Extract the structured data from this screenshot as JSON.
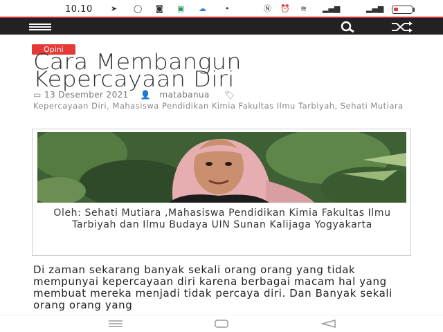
{
  "status_bar": {
    "time": "10.10",
    "icons": [
      "telegram-icon",
      "whatsapp-icon",
      "camera-icon",
      "app-icon",
      "cloud-icon",
      "dot-icon",
      "nfc-icon",
      "alarm-icon",
      "wifi-icon",
      "signal-icon"
    ],
    "battery_level": 0.25,
    "battery_color": "#e53935"
  },
  "header": {
    "menu_icon": "hamburger-menu-icon",
    "search_icon": "search-icon",
    "shuffle_icon": "shuffle-icon",
    "background": "#222222",
    "accent": "#d32f2f"
  },
  "article": {
    "category": "Opini",
    "title_line1": "Cara Membangun",
    "title_line2": "Kepercayaan Diri",
    "date": "13 Desember 2021",
    "author": "matabanua",
    "tags": [
      "Kepercayaan Diri",
      "Mahasiswa Pendidikan Kimia Fakultas Ilmu Tarbiyah",
      "Sehati Mutiara"
    ],
    "caption": "Oleh: Sehati Mutiara ,Mahasiswa Pendidikan Kimia Fakultas Ilmu Tarbiyah dan Ilmu Budaya UIN Sunan Kalijaga Yogyakarta",
    "body": "Di zaman sekarang banyak sekali orang orang yang tidak mempunyai kepercayaan diri karena berbagai macam hal yang membuat mereka menjadi tidak percaya diri. Dan Banyak sekali orang orang yang"
  },
  "nav_bar": {
    "icons": [
      "recent-apps-icon",
      "home-icon",
      "back-icon"
    ]
  }
}
